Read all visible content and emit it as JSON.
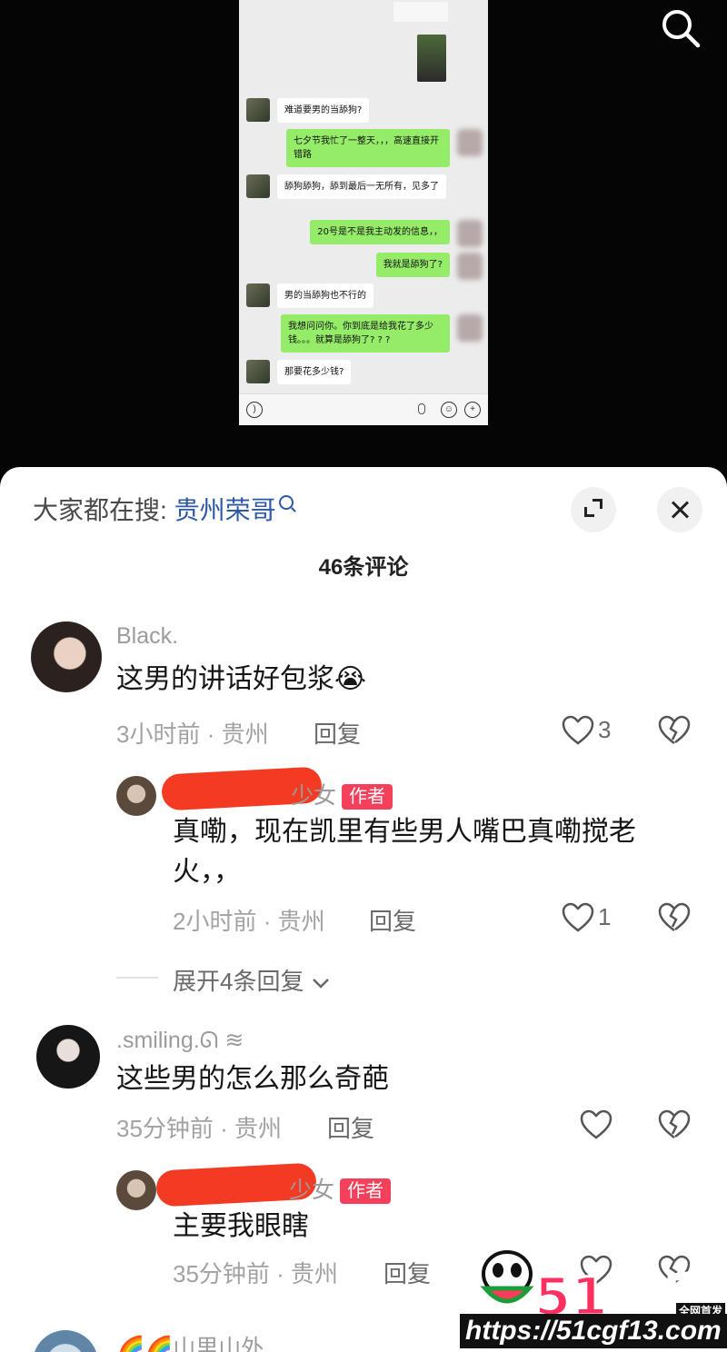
{
  "video": {
    "chat": [
      {
        "side": "in",
        "text": "难道要男的当舔狗?"
      },
      {
        "side": "out",
        "text": "七夕节我忙了一整天，，，高速直接开错路"
      },
      {
        "side": "in",
        "text": "舔狗舔狗，舔到最后一无所有，见多了"
      },
      {
        "side": "out",
        "text": "20号是不是我主动发的信息，，"
      },
      {
        "side": "out",
        "text": "我就是舔狗了?"
      },
      {
        "side": "in",
        "text": "男的当舔狗也不行的"
      },
      {
        "side": "out",
        "text": "我想问问你。你到底是给我花了多少钱。。。就算是舔狗了? ? ?"
      },
      {
        "side": "in",
        "text": "那要花多少钱?"
      }
    ],
    "search_icon": "search-icon"
  },
  "sheet": {
    "search_prefix": "大家都在搜:",
    "search_term": "贵州荣哥",
    "comment_count": "46条评论"
  },
  "comments": [
    {
      "name": "Black.",
      "text": "这男的讲话好包浆",
      "emoji": "😭",
      "time": "3小时前",
      "location": "贵州",
      "reply_label": "回复",
      "likes": "3"
    },
    {
      "name_suffix": "少女",
      "author_tag": "作者",
      "text": "真嘞，现在凯里有些男人嘴巴真嘞搅老火，，",
      "time": "2小时前",
      "location": "贵州",
      "reply_label": "回复",
      "likes": "1"
    },
    {
      "expand_label": "展开4条回复"
    },
    {
      "name": ".smiling.ᘏ ≋",
      "text": "这些男的怎么那么奇葩",
      "time": "35分钟前",
      "location": "贵州",
      "reply_label": "回复",
      "likes": ""
    },
    {
      "name_suffix": "少女",
      "author_tag": "作者",
      "text": "主要我眼瞎",
      "time": "35分钟前",
      "location": "贵州",
      "reply_label": "回复",
      "likes": ""
    },
    {
      "name": "🌈🌈山里山外"
    }
  ],
  "watermark": {
    "logo": "51吃瓜",
    "badge": "全网首发",
    "url": "https://51cgf13.com"
  },
  "colors": {
    "accent_link": "#2c58a4",
    "author_tag": "#f4405b",
    "chat_out": "#95ec69"
  }
}
